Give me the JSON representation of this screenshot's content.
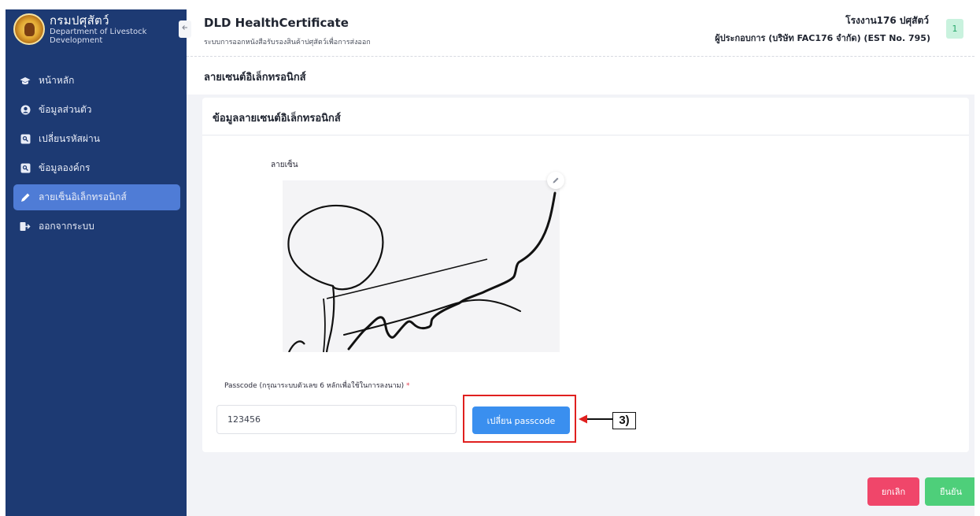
{
  "brand": {
    "name_th": "กรมปศุสัตว์",
    "name_en": "Department of Livestock Development"
  },
  "header": {
    "title": "DLD HealthCertificate",
    "subtitle": "ระบบการออกหนังสือรับรองสินค้าปศุสัตว์เพื่อการส่งออก",
    "company": "โรงงาน176 ปศุสัตว์",
    "operator": "ผู้ประกอบการ (บริษัท FAC176 จำกัด) (EST No. 795)",
    "avatar": "1"
  },
  "sidebar": {
    "items": [
      {
        "label": "หน้าหลัก",
        "icon": "graduation-cap-icon"
      },
      {
        "label": "ข้อมูลส่วนตัว",
        "icon": "user-circle-icon"
      },
      {
        "label": "เปลี่ยนรหัสผ่าน",
        "icon": "key-icon"
      },
      {
        "label": "ข้อมูลองค์กร",
        "icon": "building-icon"
      },
      {
        "label": "ลายเซ็นอิเล็กทรอนิกส์",
        "icon": "pen-icon",
        "active": true
      },
      {
        "label": "ออกจากระบบ",
        "icon": "logout-icon"
      }
    ]
  },
  "page": {
    "breadcrumb_title": "ลายเซนต์อิเล็กทรอนิกส์",
    "card_title": "ข้อมูลลายเซนต์อิเล็กทรอนิกส์",
    "signature_label": "ลายเซ็น",
    "passcode_label": "Passcode (กรุณาระบบตัวเลข 6 หลักเพื่อใช้ในการลงนาม)",
    "passcode_required_mark": "*",
    "passcode_value": "123456",
    "change_passcode_label": "เปลี่ยน passcode",
    "annotation": "3)"
  },
  "actions": {
    "cancel_label": "ยกเลิก",
    "confirm_label": "ยืนยัน"
  },
  "colors": {
    "sidebar_bg": "#1d3a73",
    "active_item": "#4f7cd6",
    "primary": "#3a8fef",
    "danger": "#f0466a",
    "success": "#4ecf7a",
    "highlight": "#e0201f"
  }
}
